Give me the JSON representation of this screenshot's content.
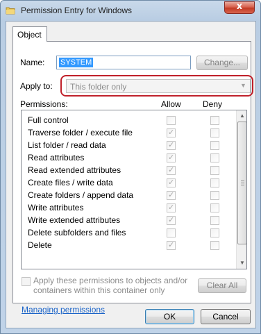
{
  "window": {
    "title": "Permission Entry for Windows",
    "icon": "folder-icon",
    "close_label": "x"
  },
  "tabs": [
    {
      "label": "Object",
      "selected": true
    }
  ],
  "name": {
    "label": "Name:",
    "value": "SYSTEM",
    "change_button": "Change..."
  },
  "apply_to": {
    "label": "Apply to:",
    "value": "This folder only",
    "enabled": false
  },
  "permissions": {
    "header": "Permissions:",
    "allow_header": "Allow",
    "deny_header": "Deny",
    "rows": [
      {
        "label": "Full control",
        "allow": false,
        "deny": false
      },
      {
        "label": "Traverse folder / execute file",
        "allow": true,
        "deny": false
      },
      {
        "label": "List folder / read data",
        "allow": true,
        "deny": false
      },
      {
        "label": "Read attributes",
        "allow": true,
        "deny": false
      },
      {
        "label": "Read extended attributes",
        "allow": true,
        "deny": false
      },
      {
        "label": "Create files / write data",
        "allow": true,
        "deny": false
      },
      {
        "label": "Create folders / append data",
        "allow": true,
        "deny": false
      },
      {
        "label": "Write attributes",
        "allow": true,
        "deny": false
      },
      {
        "label": "Write extended attributes",
        "allow": true,
        "deny": false
      },
      {
        "label": "Delete subfolders and files",
        "allow": false,
        "deny": false
      },
      {
        "label": "Delete",
        "allow": true,
        "deny": false
      }
    ]
  },
  "apply_inherit": {
    "text": "Apply these permissions to objects and/or containers within this container only",
    "checked": false
  },
  "clear_all_button": "Clear All",
  "managing_link": "Managing permissions",
  "ok_button": "OK",
  "cancel_button": "Cancel",
  "colors": {
    "highlight": "#c0202a",
    "link": "#1a63c8",
    "selection": "#3399ff"
  }
}
